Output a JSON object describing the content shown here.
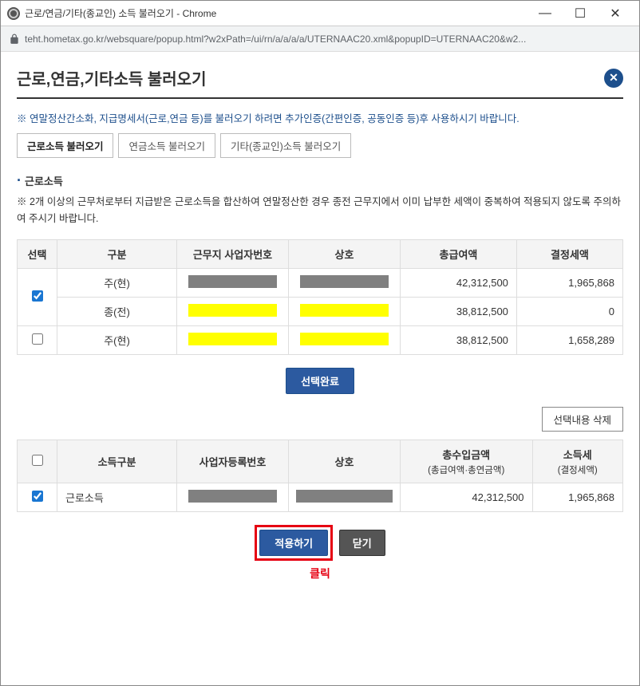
{
  "window": {
    "title": "근로/연금/기타(종교인) 소득 불러오기 - Chrome",
    "url": "teht.hometax.go.kr/websquare/popup.html?w2xPath=/ui/rn/a/a/a/a/UTERNAAC20.xml&popupID=UTERNAAC20&w2..."
  },
  "page": {
    "title": "근로,연금,기타소득 불러오기",
    "notice": "※ 연말정산간소화, 지급명세서(근로,연금 등)를 불러오기 하려면 추가인증(간편인증, 공동인증 등)후 사용하시기 바랍니다."
  },
  "tabs": [
    {
      "label": "근로소득 불러오기",
      "active": true
    },
    {
      "label": "연금소득 불러오기",
      "active": false
    },
    {
      "label": "기타(종교인)소득 불러오기",
      "active": false
    }
  ],
  "section": {
    "title": "근로소득",
    "note": "※ 2개 이상의 근무처로부터 지급받은 근로소득을 합산하여 연말정산한 경우 종전 근무지에서 이미 납부한 세액이 중복하여 적용되지 않도록 주의하여 주시기 바랍니다."
  },
  "table1": {
    "headers": [
      "선택",
      "구분",
      "근무지 사업자번호",
      "상호",
      "총급여액",
      "결정세액"
    ],
    "groups": [
      {
        "checked": true,
        "rows": [
          {
            "gubun": "주(현)",
            "redact": "gray",
            "total": "42,312,500",
            "tax": "1,965,868"
          },
          {
            "gubun": "종(전)",
            "redact": "yellow",
            "total": "38,812,500",
            "tax": "0"
          }
        ]
      },
      {
        "checked": false,
        "rows": [
          {
            "gubun": "주(현)",
            "redact": "yellow",
            "total": "38,812,500",
            "tax": "1,658,289"
          }
        ]
      }
    ]
  },
  "buttons": {
    "select_done": "선택완료",
    "delete_selected": "선택내용 삭제",
    "apply": "적용하기",
    "close": "닫기",
    "click_label": "클릭"
  },
  "table2": {
    "headers": {
      "select": "",
      "gubun": "소득구분",
      "bizno": "사업자등록번호",
      "company": "상호",
      "total": "총수입금액",
      "total_sub": "(총급여액·총연금액)",
      "tax": "소득세",
      "tax_sub": "(결정세액)"
    },
    "rows": [
      {
        "checked": true,
        "gubun": "근로소득",
        "redact": "gray",
        "total": "42,312,500",
        "tax": "1,965,868"
      }
    ]
  }
}
